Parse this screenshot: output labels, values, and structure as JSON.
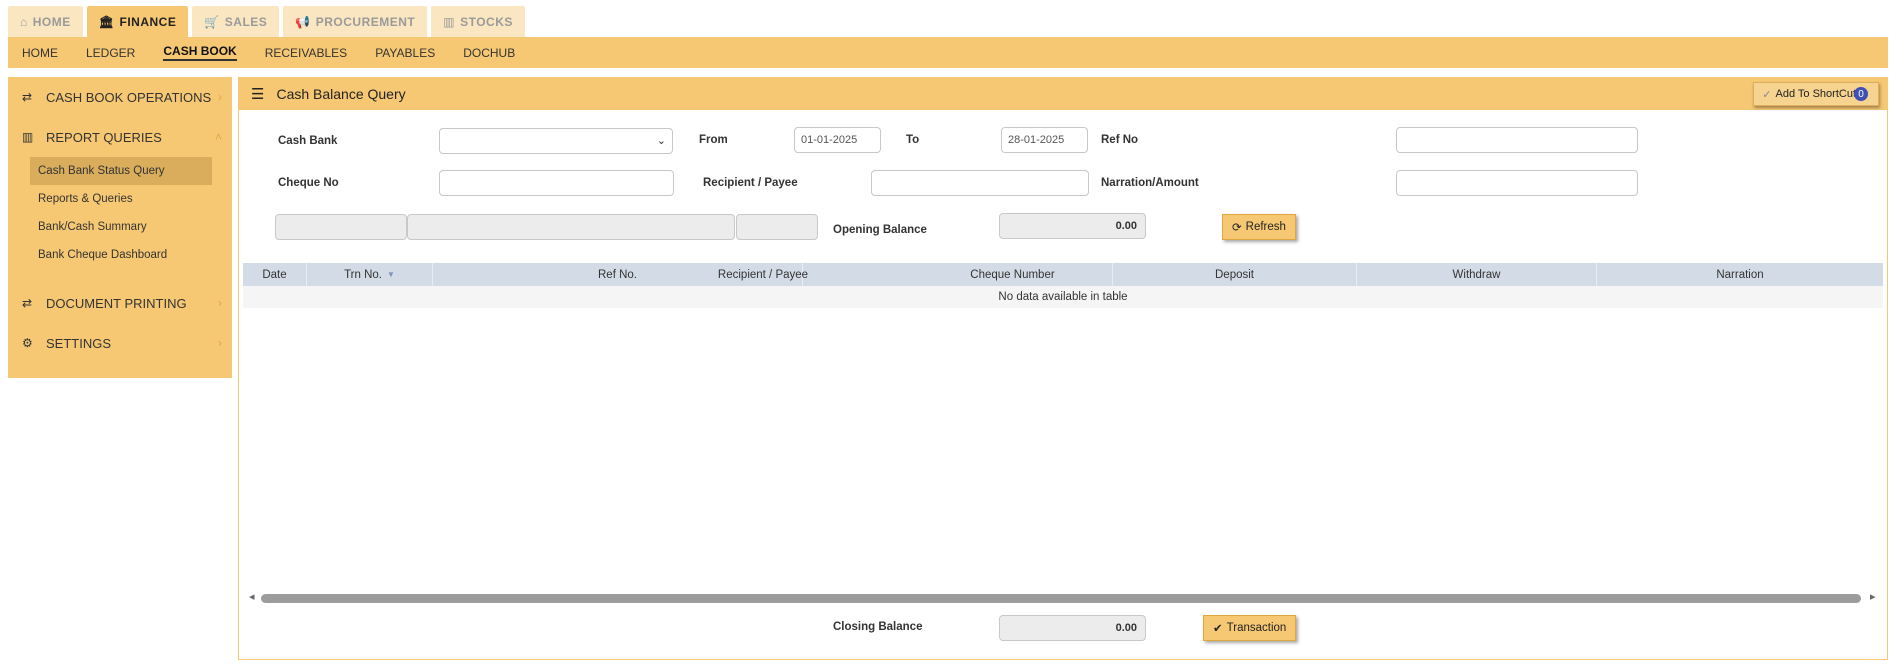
{
  "top_tabs": [
    {
      "label": "HOME",
      "icon": "home-icon"
    },
    {
      "label": "FINANCE",
      "icon": "bank-icon"
    },
    {
      "label": "SALES",
      "icon": "cart-icon"
    },
    {
      "label": "PROCUREMENT",
      "icon": "megaphone-icon"
    },
    {
      "label": "STOCKS",
      "icon": "bar-chart-icon"
    }
  ],
  "sub_menu": [
    "HOME",
    "LEDGER",
    "CASH BOOK",
    "RECEIVABLES",
    "PAYABLES",
    "DOCHUB"
  ],
  "sidebar": {
    "groups": [
      {
        "label": "CASH BOOK OPERATIONS"
      },
      {
        "label": "REPORT QUERIES"
      },
      {
        "label": "DOCUMENT PRINTING"
      },
      {
        "label": "SETTINGS"
      }
    ],
    "report_items": [
      "Cash Bank Status Query",
      "Reports & Queries",
      "Bank/Cash Summary",
      "Bank Cheque Dashboard"
    ]
  },
  "panel": {
    "title": "Cash Balance Query",
    "shortcut_label": "Add To ShortCut",
    "shortcut_count": "0"
  },
  "form": {
    "cash_bank_label": "Cash Bank",
    "from_label": "From",
    "from_value": "01-01-2025",
    "to_label": "To",
    "to_value": "28-01-2025",
    "ref_no_label": "Ref No",
    "cheque_no_label": "Cheque No",
    "recipient_label": "Recipient / Payee",
    "narration_label": "Narration/Amount",
    "opening_balance_label": "Opening Balance",
    "opening_balance_value": "0.00",
    "refresh_label": "Refresh",
    "closing_balance_label": "Closing Balance",
    "closing_balance_value": "0.00",
    "transaction_label": "Transaction"
  },
  "table": {
    "columns": [
      "Date",
      "Trn No.",
      "Ref No.",
      "Recipient / Payee",
      "Cheque Number",
      "Deposit",
      "Withdraw",
      "Narration"
    ],
    "empty_text": "No data available in table"
  }
}
